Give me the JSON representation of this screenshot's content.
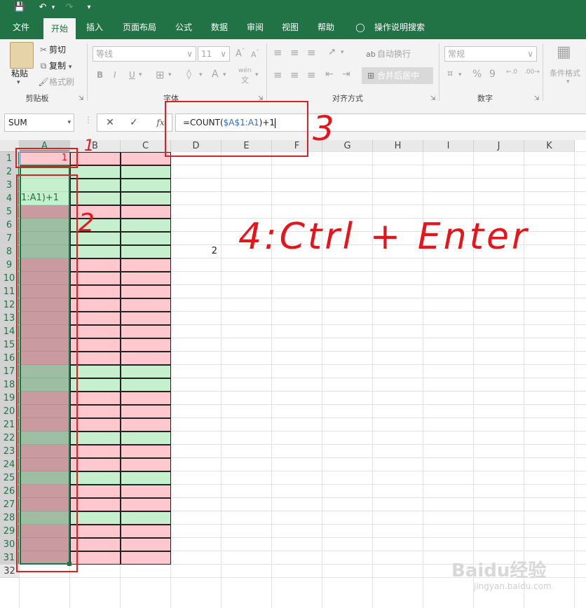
{
  "quick_access": {
    "save_icon": "save-icon",
    "undo_icon": "undo-icon",
    "redo_icon": "redo-icon",
    "customize_icon": "customize-qat-icon"
  },
  "ribbon_tabs": [
    "文件",
    "开始",
    "插入",
    "页面布局",
    "公式",
    "数据",
    "审阅",
    "视图",
    "帮助"
  ],
  "active_tab": "开始",
  "tell_me": "操作说明搜索",
  "clipboard": {
    "paste": "粘贴",
    "cut": "剪切",
    "copy": "复制",
    "format_painter": "格式刷",
    "group": "剪贴板"
  },
  "font": {
    "name": "等线",
    "size": "11",
    "group": "字体",
    "bold": "B",
    "italic": "I",
    "underline": "U",
    "grow": "A",
    "shrink": "A",
    "color": "A",
    "phonetic": "wén"
  },
  "alignment": {
    "wrap": "自动换行",
    "merge": "合并后居中",
    "group": "对齐方式"
  },
  "number": {
    "format": "常规",
    "group": "数字",
    "percent": "%",
    "comma": "9"
  },
  "styles": {
    "conditional": "条件格式"
  },
  "formula_bar": {
    "name_box": "SUM",
    "formula_prefix": "=COUNT(",
    "formula_ref": "$A$1:A1",
    "formula_suffix": ")+1",
    "fx": "fx"
  },
  "columns": [
    "A",
    "B",
    "C",
    "D",
    "E",
    "F",
    "G",
    "H",
    "I",
    "J",
    "K"
  ],
  "rows": [
    "1",
    "2",
    "3",
    "4",
    "5",
    "6",
    "7",
    "8",
    "9",
    "10",
    "11",
    "12",
    "13",
    "14",
    "15",
    "16",
    "17",
    "18",
    "19",
    "20",
    "21",
    "22",
    "23",
    "24",
    "25",
    "26",
    "27",
    "28",
    "29",
    "30",
    "31",
    "32"
  ],
  "cells": {
    "a1": "1",
    "a4_overflow": "1:A1)+1",
    "e8": "2"
  },
  "row_colors": [
    "pink",
    "green",
    "green",
    "green",
    "pink",
    "green",
    "green",
    "green",
    "pink",
    "pink",
    "pink",
    "pink",
    "pink",
    "pink",
    "pink",
    "pink",
    "green",
    "green",
    "pink",
    "pink",
    "pink",
    "green",
    "pink",
    "pink",
    "green",
    "pink",
    "pink",
    "green",
    "pink",
    "pink",
    "pink"
  ],
  "colors": {
    "pink": "#ffc7ce",
    "green": "#c6efce",
    "pink_sel": "#c99aa0",
    "green_sel": "#9dbea3",
    "excel_green": "#217346",
    "annotation": "#e8141c"
  },
  "annotations": {
    "n1": "1",
    "n2": "2",
    "n3": "3",
    "n4": "4:Ctrl + Enter"
  },
  "watermark": {
    "logo": "Baidu经验",
    "url": "jingyan.baidu.com"
  }
}
